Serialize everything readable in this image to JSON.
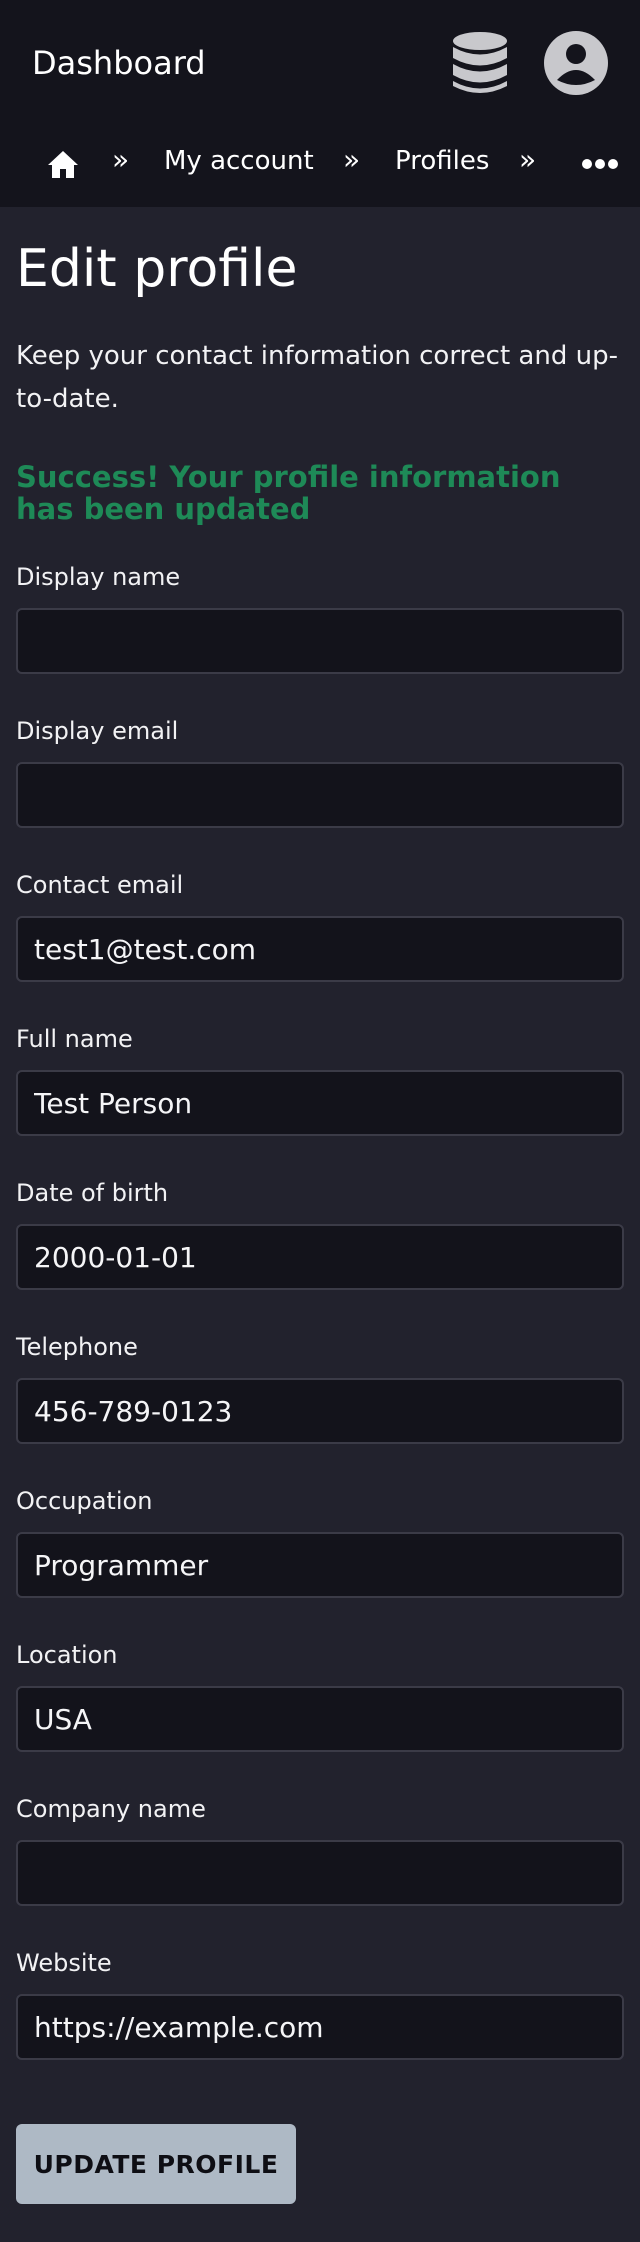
{
  "header": {
    "title": "Dashboard",
    "icons": [
      "database-icon",
      "user-avatar-icon"
    ]
  },
  "breadcrumb": {
    "items": [
      {
        "icon": "home-icon"
      },
      {
        "label": "My account"
      },
      {
        "label": "Profiles"
      }
    ],
    "separator": "»",
    "overflow_icon": "more-horizontal-icon"
  },
  "page": {
    "title": "Edit profile",
    "subtitle": "Keep your contact information correct and up-to-date.",
    "success_message": "Success! Your profile information has been updated"
  },
  "form": {
    "fields": [
      {
        "label": "Display name",
        "value": ""
      },
      {
        "label": "Display email",
        "value": ""
      },
      {
        "label": "Contact email",
        "value": "test1@test.com"
      },
      {
        "label": "Full name",
        "value": "Test Person"
      },
      {
        "label": "Date of birth",
        "value": "2000-01-01"
      },
      {
        "label": "Telephone",
        "value": "456-789-0123"
      },
      {
        "label": "Occupation",
        "value": "Programmer"
      },
      {
        "label": "Location",
        "value": "USA"
      },
      {
        "label": "Company name",
        "value": ""
      },
      {
        "label": "Website",
        "value": "https://example.com"
      }
    ],
    "submit_label": "UPDATE PROFILE"
  },
  "colors": {
    "background": "#22222d",
    "header_background": "#14141c",
    "success": "#1e8a57",
    "button": "#aeb9c5"
  }
}
